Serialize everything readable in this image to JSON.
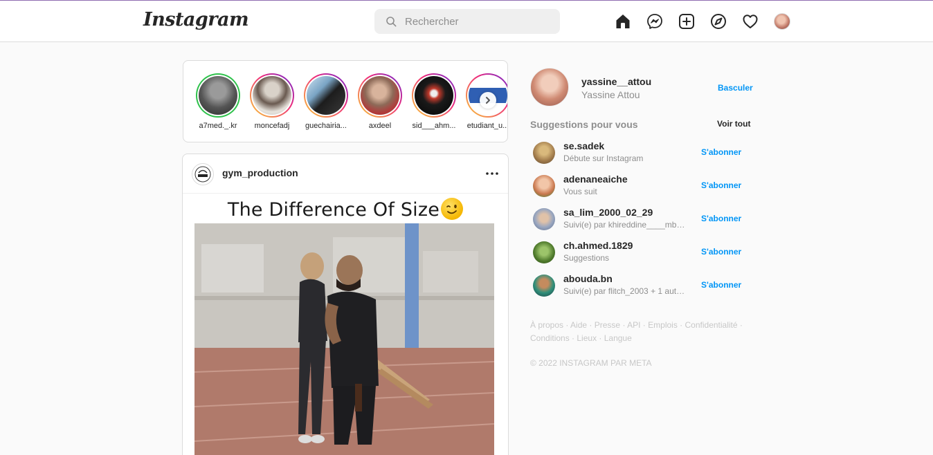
{
  "header": {
    "logo": "Instagram",
    "search_placeholder": "Rechercher",
    "icons": [
      "home-icon",
      "messenger-icon",
      "new-post-icon",
      "explore-icon",
      "activity-heart-icon",
      "profile-avatar"
    ]
  },
  "stories": [
    {
      "name": "a7med._.kr"
    },
    {
      "name": "moncefadj"
    },
    {
      "name": "guechairia..."
    },
    {
      "name": "axdeel"
    },
    {
      "name": "sid___ahm..."
    },
    {
      "name": "etudiant_u..."
    }
  ],
  "post": {
    "username": "gym_production",
    "avatar_text": "GYM",
    "media_title": "The Difference Of Size",
    "media_emoji": "winking-face-emoji"
  },
  "sidebar": {
    "username": "yassine__attou",
    "fullname": "Yassine Attou",
    "switch_label": "Basculer",
    "suggestions_title": "Suggestions pour vous",
    "see_all_label": "Voir tout",
    "suggestions": [
      {
        "username": "se.sadek",
        "subtitle": "Débute sur Instagram",
        "action": "S'abonner"
      },
      {
        "username": "adenaneaiche",
        "subtitle": "Vous suit",
        "action": "S'abonner"
      },
      {
        "username": "sa_lim_2000_02_29",
        "subtitle": "Suivi(e) par khireddine____mbk ...",
        "action": "S'abonner"
      },
      {
        "username": "ch.ahmed.1829",
        "subtitle": "Suggestions",
        "action": "S'abonner"
      },
      {
        "username": "abouda.bn",
        "subtitle": "Suivi(e) par flitch_2003 + 1 autr...",
        "action": "S'abonner"
      }
    ],
    "footer_links": [
      "À propos",
      "Aide",
      "Presse",
      "API",
      "Emplois",
      "Confidentialité",
      "Conditions",
      "Lieux",
      "Langue"
    ],
    "copyright": "© 2022 INSTAGRAM PAR META"
  },
  "colors": {
    "accent_blue": "#0095f6",
    "story_ring_gradient": [
      "#f9ce34",
      "#ee2a7b",
      "#6228d7"
    ],
    "close_friends_ring": "#2ec14b",
    "border": "#dbdbdb",
    "background": "#fafafa"
  }
}
